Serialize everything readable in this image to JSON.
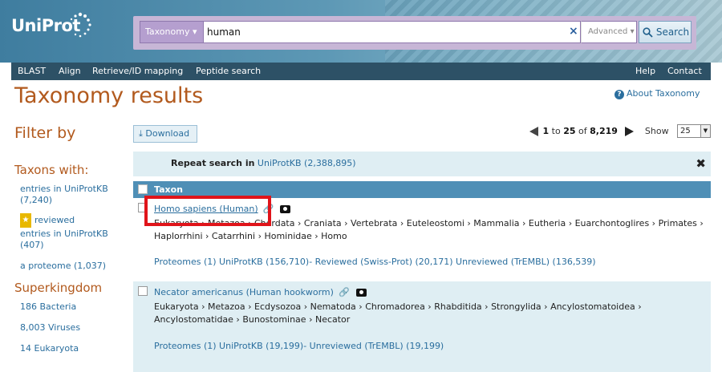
{
  "header": {
    "logo": "UniProt",
    "search_category": "Taxonomy",
    "search_value": "human",
    "clear_symbol": "×",
    "advanced_label": "Advanced",
    "search_button": "Search"
  },
  "nav": {
    "items": [
      "BLAST",
      "Align",
      "Retrieve/ID mapping",
      "Peptide search"
    ],
    "right_items": [
      "Help",
      "Contact"
    ]
  },
  "page": {
    "title": "Taxonomy results",
    "about": "About Taxonomy"
  },
  "sidebar": {
    "filter_by": "Filter by",
    "taxons_heading": "Taxons with:",
    "entries_link": "entries in UniProtKB (7,240)",
    "reviewed_link_a": "reviewed",
    "reviewed_link_b": "entries in UniProtKB",
    "reviewed_count": "(407)",
    "proteome_link": "a proteome (1,037)",
    "superkingdom_heading": "Superkingdom",
    "sk_items": [
      "186 Bacteria",
      "8,003 Viruses",
      "14 Eukaryota"
    ]
  },
  "toolbar": {
    "download": "Download",
    "pager_from": "1",
    "pager_to": "to",
    "pager_page": "25",
    "pager_of": "of",
    "pager_total": "8,219",
    "show_label": "Show",
    "show_value": "25"
  },
  "repeat": {
    "prefix": "Repeat search in",
    "target": "UniProtKB",
    "count": "(2,388,895)"
  },
  "table": {
    "header": "Taxon",
    "rows": [
      {
        "name": "Homo sapiens (Human)",
        "lineage_1": "Eukaryota › Metazoa › Chordata › Craniata › Vertebrata › Euteleostomi › Mammalia › Eutheria › Euarchontoglires › Primates ›",
        "lineage_2": "Haplorrhini › Catarrhini › Hominidae › Homo",
        "links": "Proteomes (1) UniProtKB (156,710)- Reviewed (Swiss-Prot) (20,171) Unreviewed (TrEMBL) (136,539)"
      },
      {
        "name": "Necator americanus (Human hookworm)",
        "lineage_1": "Eukaryota › Metazoa › Ecdysozoa › Nematoda › Chromadorea › Rhabditida › Strongylida › Ancylostomatoidea ›",
        "lineage_2": "Ancylostomatidae › Bunostominae › Necator",
        "links": "Proteomes (1) UniProtKB (19,199)- Unreviewed (TrEMBL) (19,199)"
      }
    ]
  },
  "colors": {
    "accent_orange": "#b25a1e",
    "link_blue": "#2a6e9e",
    "highlight_red": "#e0141a"
  }
}
